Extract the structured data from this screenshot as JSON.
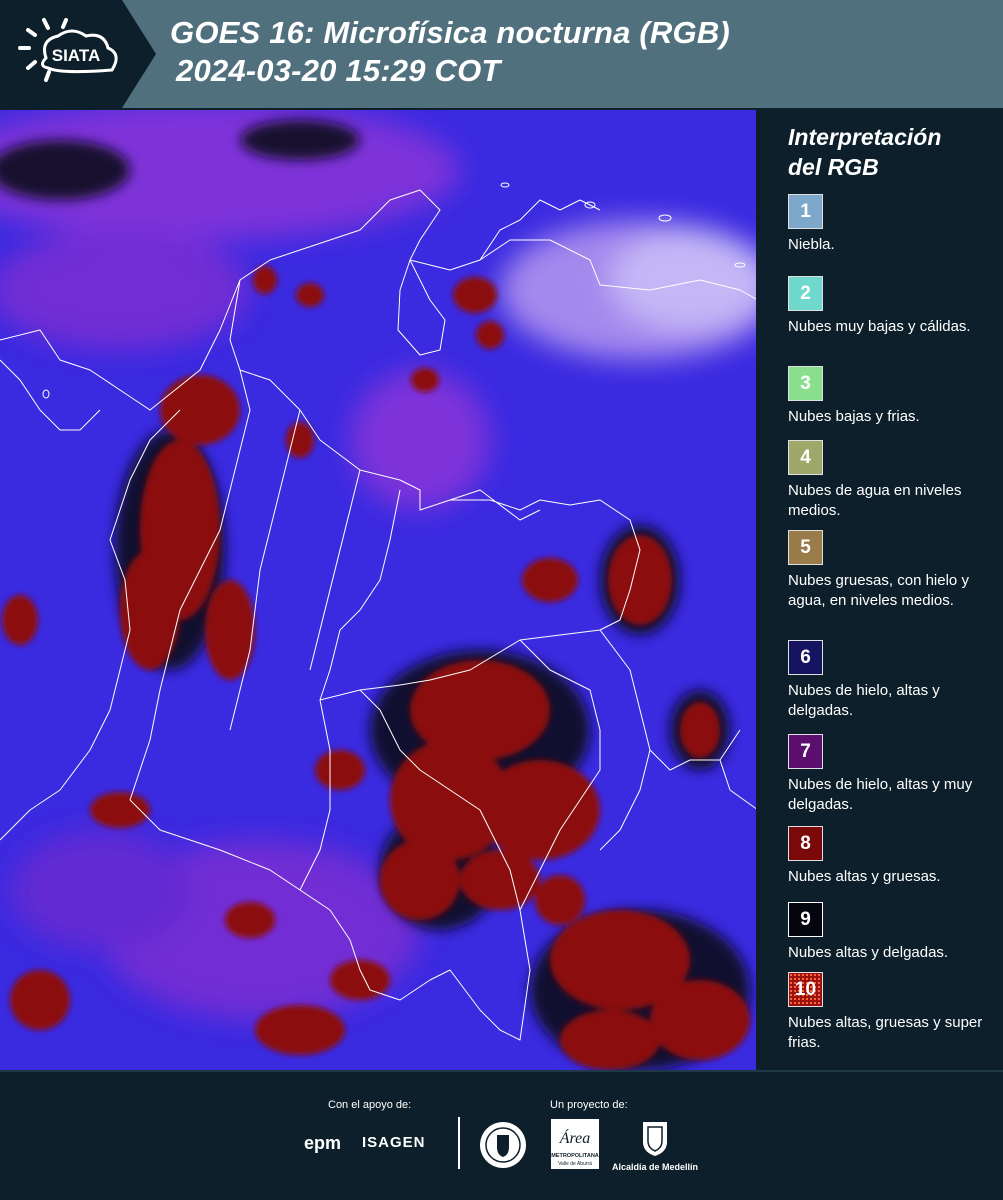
{
  "header": {
    "logo_text": "SIATA",
    "title_line1": "GOES 16: Microfísica nocturna (RGB)",
    "title_line2": "2024-03-20 15:29 COT",
    "background_color": "#50707e"
  },
  "map": {
    "icon": "satellite-rgb-map",
    "colors": {
      "background": "#3a2ae0",
      "purple": "#8a34d8",
      "light": "#d6c8f8",
      "dark_red": "#8c0d0b",
      "black": "#0a0a1e",
      "borders": "#ffffff"
    }
  },
  "legend": {
    "title_line1": "Interpretación",
    "title_line2": "del RGB",
    "items": [
      {
        "number": "1",
        "label": "Niebla.",
        "color": "#7ea7cc"
      },
      {
        "number": "2",
        "label": "Nubes muy bajas y cálidas.",
        "color": "#6ed9cc"
      },
      {
        "number": "3",
        "label": "Nubes bajas y frias.",
        "color": "#8adf8e"
      },
      {
        "number": "4",
        "label": "Nubes de agua en niveles medios.",
        "color": "#9ea86a"
      },
      {
        "number": "5",
        "label": "Nubes gruesas, con hielo y agua, en niveles medios.",
        "color": "#9a7b4a"
      },
      {
        "number": "6",
        "label": "Nubes de hielo, altas y delgadas.",
        "color": "#141460"
      },
      {
        "number": "7",
        "label": "Nubes de hielo, altas y muy delgadas.",
        "color": "#5c0f6e"
      },
      {
        "number": "8",
        "label": "Nubes altas y gruesas.",
        "color": "#7a0a0a"
      },
      {
        "number": "9",
        "label": "Nubes altas y delgadas.",
        "color": "#050510"
      },
      {
        "number": "10",
        "label": "Nubes altas, gruesas y super frias.",
        "color": "#a51510"
      }
    ]
  },
  "footer": {
    "support_label": "Con el apoyo de:",
    "project_label": "Un proyecto de:",
    "sponsor1": "epm",
    "sponsor2": "ISAGEN",
    "area_line1": "METROPOLITANA",
    "area_line2": "Valle de Aburrá",
    "alcaldia": "Alcaldía de Medellín"
  }
}
